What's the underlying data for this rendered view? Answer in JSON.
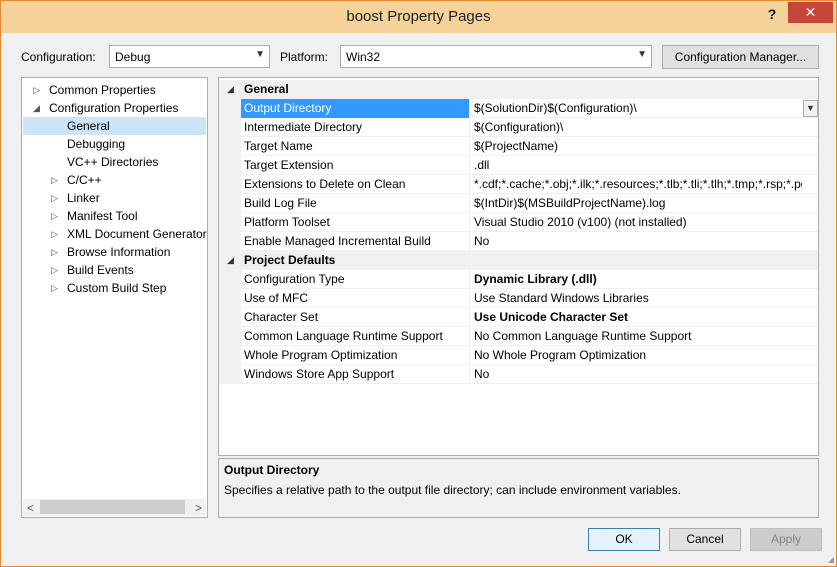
{
  "window": {
    "title": "boost Property Pages",
    "help": "?",
    "close": "✕"
  },
  "toolbar": {
    "configuration_label": "Configuration:",
    "configuration_value": "Debug",
    "platform_label": "Platform:",
    "platform_value": "Win32",
    "config_manager_button": "Configuration Manager..."
  },
  "tree": {
    "items": [
      {
        "label": "Common Properties",
        "expander": "▷"
      },
      {
        "label": "Configuration Properties",
        "expander": "◢"
      },
      {
        "label": "General"
      },
      {
        "label": "Debugging"
      },
      {
        "label": "VC++ Directories"
      },
      {
        "label": "C/C++",
        "expander": "▷"
      },
      {
        "label": "Linker",
        "expander": "▷"
      },
      {
        "label": "Manifest Tool",
        "expander": "▷"
      },
      {
        "label": "XML Document Generator",
        "expander": "▷"
      },
      {
        "label": "Browse Information",
        "expander": "▷"
      },
      {
        "label": "Build Events",
        "expander": "▷"
      },
      {
        "label": "Custom Build Step",
        "expander": "▷"
      }
    ],
    "selected": "General"
  },
  "grid": {
    "sections": [
      {
        "title": "General",
        "rows": [
          {
            "name": "Output Directory",
            "value": "$(SolutionDir)$(Configuration)\\"
          },
          {
            "name": "Intermediate Directory",
            "value": "$(Configuration)\\"
          },
          {
            "name": "Target Name",
            "value": "$(ProjectName)"
          },
          {
            "name": "Target Extension",
            "value": ".dll"
          },
          {
            "name": "Extensions to Delete on Clean",
            "value": "*.cdf;*.cache;*.obj;*.ilk;*.resources;*.tlb;*.tli;*.tlh;*.tmp;*.rsp;*.pgc;*.pgd;*.meta;*.tlog;*.manifest;*.res;*.pch;*.exp;*.idb;*.rep;*.xdc;*.pdb;*_manifest.rc;*.bsc;*.sbr;*.xml;*.metagen;*.bi"
          },
          {
            "name": "Build Log File",
            "value": "$(IntDir)$(MSBuildProjectName).log"
          },
          {
            "name": "Platform Toolset",
            "value": "Visual Studio 2010 (v100) (not installed)"
          },
          {
            "name": "Enable Managed Incremental Build",
            "value": "No"
          }
        ]
      },
      {
        "title": "Project Defaults",
        "rows": [
          {
            "name": "Configuration Type",
            "value": "Dynamic Library (.dll)"
          },
          {
            "name": "Use of MFC",
            "value": "Use Standard Windows Libraries"
          },
          {
            "name": "Character Set",
            "value": "Use Unicode Character Set"
          },
          {
            "name": "Common Language Runtime Support",
            "value": "No Common Language Runtime Support"
          },
          {
            "name": "Whole Program Optimization",
            "value": "No Whole Program Optimization"
          },
          {
            "name": "Windows Store App Support",
            "value": "No"
          }
        ]
      }
    ],
    "selected": "Output Directory"
  },
  "description": {
    "title": "Output Directory",
    "text": "Specifies a relative path to the output file directory; can include environment variables."
  },
  "buttons": {
    "ok": "OK",
    "cancel": "Cancel",
    "apply": "Apply"
  },
  "colors": {
    "title_bar": "#f4d29a",
    "close": "#c7463a",
    "selection": "#3399ff",
    "tree_selection": "#cce4f7"
  }
}
